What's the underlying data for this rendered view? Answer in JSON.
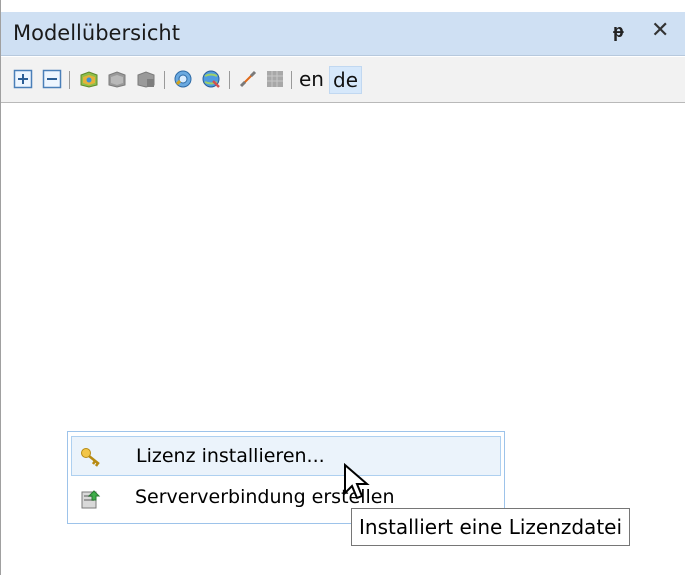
{
  "panel": {
    "title": "Modellübersicht",
    "pin_glyph": "ᵽ",
    "close_glyph": "✕"
  },
  "toolbar": {
    "buttons": [
      {
        "icon": "expand-all-icon"
      },
      {
        "icon": "collapse-all-icon"
      },
      {
        "icon": "open-model-icon"
      },
      {
        "icon": "model-disabled-icon"
      },
      {
        "icon": "model-save-disabled-icon"
      },
      {
        "icon": "search-globe-icon"
      },
      {
        "icon": "network-globe-icon"
      },
      {
        "icon": "link-icon"
      },
      {
        "icon": "grid-disabled-icon"
      }
    ],
    "lang_en": "en",
    "lang_de": "de"
  },
  "context_menu": {
    "items": [
      {
        "label": "Lizenz installieren...",
        "icon": "key-icon"
      },
      {
        "label": "Serververbindung erstellen",
        "icon": "server-upload-icon"
      }
    ]
  },
  "tooltip": {
    "text": "Installiert eine Lizenzdatei"
  }
}
